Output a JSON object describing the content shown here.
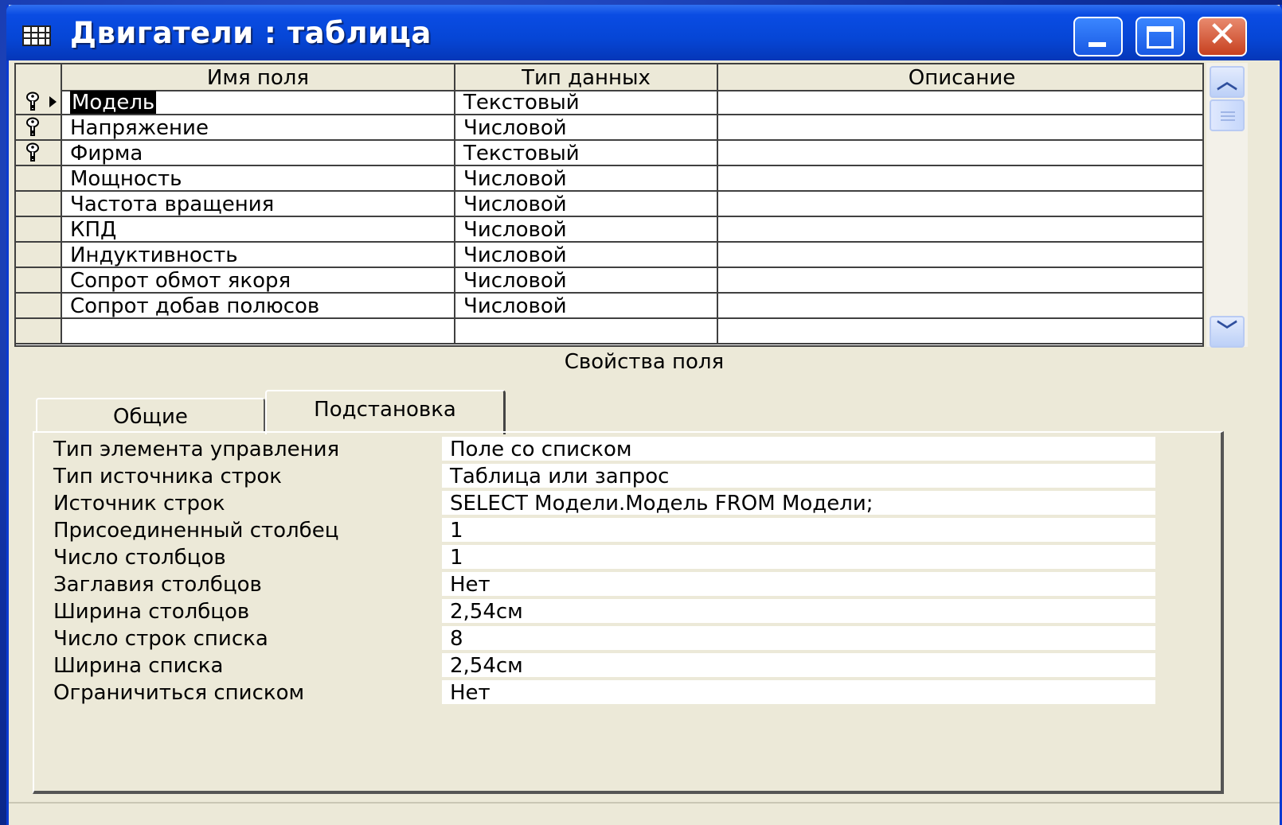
{
  "window": {
    "title": "Двигатели : таблица",
    "buttons": {
      "minimize": "",
      "maximize": "",
      "close": "✕"
    }
  },
  "grid": {
    "columns": [
      "Имя поля",
      "Тип данных",
      "Описание"
    ],
    "rows": [
      {
        "name": "Модель",
        "type": "Текстовый",
        "description": "",
        "key": true,
        "current": true
      },
      {
        "name": "Напряжение",
        "type": "Числовой",
        "description": "",
        "key": true,
        "current": false
      },
      {
        "name": "Фирма",
        "type": "Текстовый",
        "description": "",
        "key": true,
        "current": false
      },
      {
        "name": "Мощность",
        "type": "Числовой",
        "description": "",
        "key": false,
        "current": false
      },
      {
        "name": "Частота вращения",
        "type": "Числовой",
        "description": "",
        "key": false,
        "current": false
      },
      {
        "name": "КПД",
        "type": "Числовой",
        "description": "",
        "key": false,
        "current": false
      },
      {
        "name": "Индуктивность",
        "type": "Числовой",
        "description": "",
        "key": false,
        "current": false
      },
      {
        "name": "Сопрот обмот якоря",
        "type": "Числовой",
        "description": "",
        "key": false,
        "current": false
      },
      {
        "name": "Сопрот добав полюсов",
        "type": "Числовой",
        "description": "",
        "key": false,
        "current": false
      },
      {
        "name": "",
        "type": "",
        "description": "",
        "key": false,
        "current": false
      }
    ]
  },
  "properties": {
    "title": "Свойства поля",
    "tabs": [
      "Общие",
      "Подстановка"
    ],
    "active_tab": "Подстановка",
    "items": [
      {
        "label": "Тип элемента управления",
        "value": "Поле со списком"
      },
      {
        "label": "Тип источника строк",
        "value": "Таблица или запрос"
      },
      {
        "label": "Источник строк",
        "value": "SELECT Модели.Модель FROM Модели;"
      },
      {
        "label": "Присоединенный столбец",
        "value": "1"
      },
      {
        "label": "Число столбцов",
        "value": "1"
      },
      {
        "label": "Заглавия столбцов",
        "value": "Нет"
      },
      {
        "label": "Ширина столбцов",
        "value": "2,54см"
      },
      {
        "label": "Число строк списка",
        "value": "8"
      },
      {
        "label": "Ширина списка",
        "value": "2,54см"
      },
      {
        "label": "Ограничиться списком",
        "value": "Нет"
      }
    ]
  },
  "colors": {
    "titlebar": "#0646d6",
    "window_bg": "#ece9d8",
    "close_button": "#c7401f",
    "desktop": "#0b2a8f"
  }
}
